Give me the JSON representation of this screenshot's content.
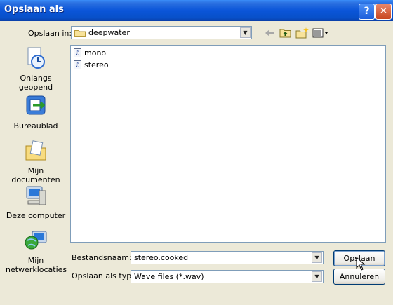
{
  "window": {
    "title": "Opslaan als"
  },
  "titlebar": {
    "help_label": "?",
    "close_label": "✕"
  },
  "location": {
    "label": "Opslaan in:",
    "value": "deepwater"
  },
  "places": [
    {
      "label_line1": "Onlangs",
      "label_line2": "geopend"
    },
    {
      "label_line1": "Bureaublad",
      "label_line2": ""
    },
    {
      "label_line1": "Mijn documenten",
      "label_line2": ""
    },
    {
      "label_line1": "Deze computer",
      "label_line2": ""
    },
    {
      "label_line1": "Mijn",
      "label_line2": "netwerklocaties"
    }
  ],
  "files": [
    {
      "name": "mono"
    },
    {
      "name": "stereo"
    }
  ],
  "filename": {
    "label": "Bestandsnaam:",
    "value": "stereo.cooked"
  },
  "filetype": {
    "label": "Opslaan als type:",
    "value": "Wave files (*.wav)"
  },
  "buttons": {
    "save": "Opslaan",
    "cancel": "Annuleren"
  },
  "toolbar": {
    "back_icon": "back-arrow-icon",
    "up_icon": "up-folder-icon",
    "new_folder_icon": "new-folder-icon",
    "views_icon": "views-menu-icon"
  }
}
